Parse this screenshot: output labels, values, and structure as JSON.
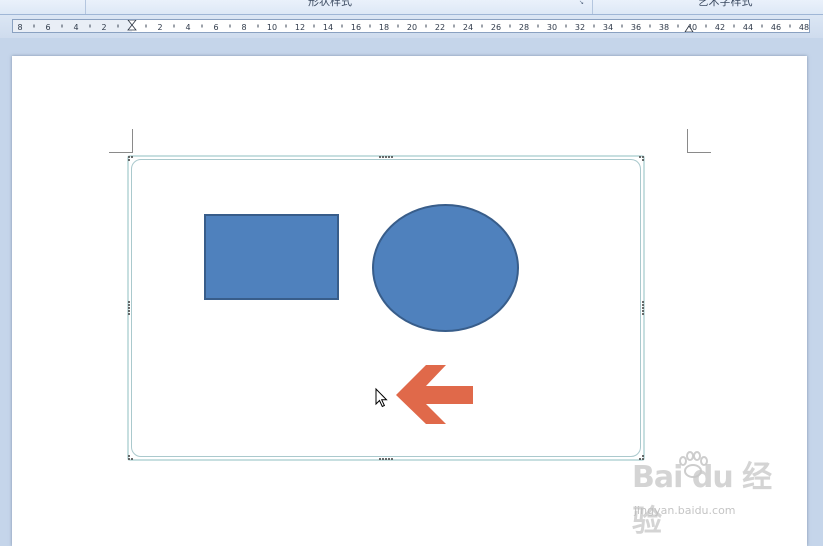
{
  "ribbon": {
    "groups": [
      {
        "label": "形状样式"
      },
      {
        "label": "艺术字样式"
      }
    ]
  },
  "ruler": {
    "left_numbers": [
      "8",
      "6",
      "4",
      "2"
    ],
    "right_numbers": [
      "2",
      "4",
      "6",
      "8",
      "10",
      "12",
      "14",
      "16",
      "18",
      "20",
      "22",
      "24",
      "26",
      "28",
      "30",
      "32",
      "34",
      "36",
      "38",
      "40",
      "42",
      "44",
      "46",
      "48"
    ]
  },
  "drawing_canvas": {
    "shapes": [
      {
        "kind": "rectangle",
        "fill": "#4f81bd",
        "stroke": "#385d8a"
      },
      {
        "kind": "ellipse",
        "fill": "#4f81bd",
        "stroke": "#385d8a"
      },
      {
        "kind": "left-arrow",
        "fill": "#e0694a"
      }
    ]
  },
  "cursor": {
    "icon": "mouse-pointer-icon"
  },
  "watermark": {
    "brand": "Bai du 经验",
    "site": "jingyan.baidu.com"
  }
}
